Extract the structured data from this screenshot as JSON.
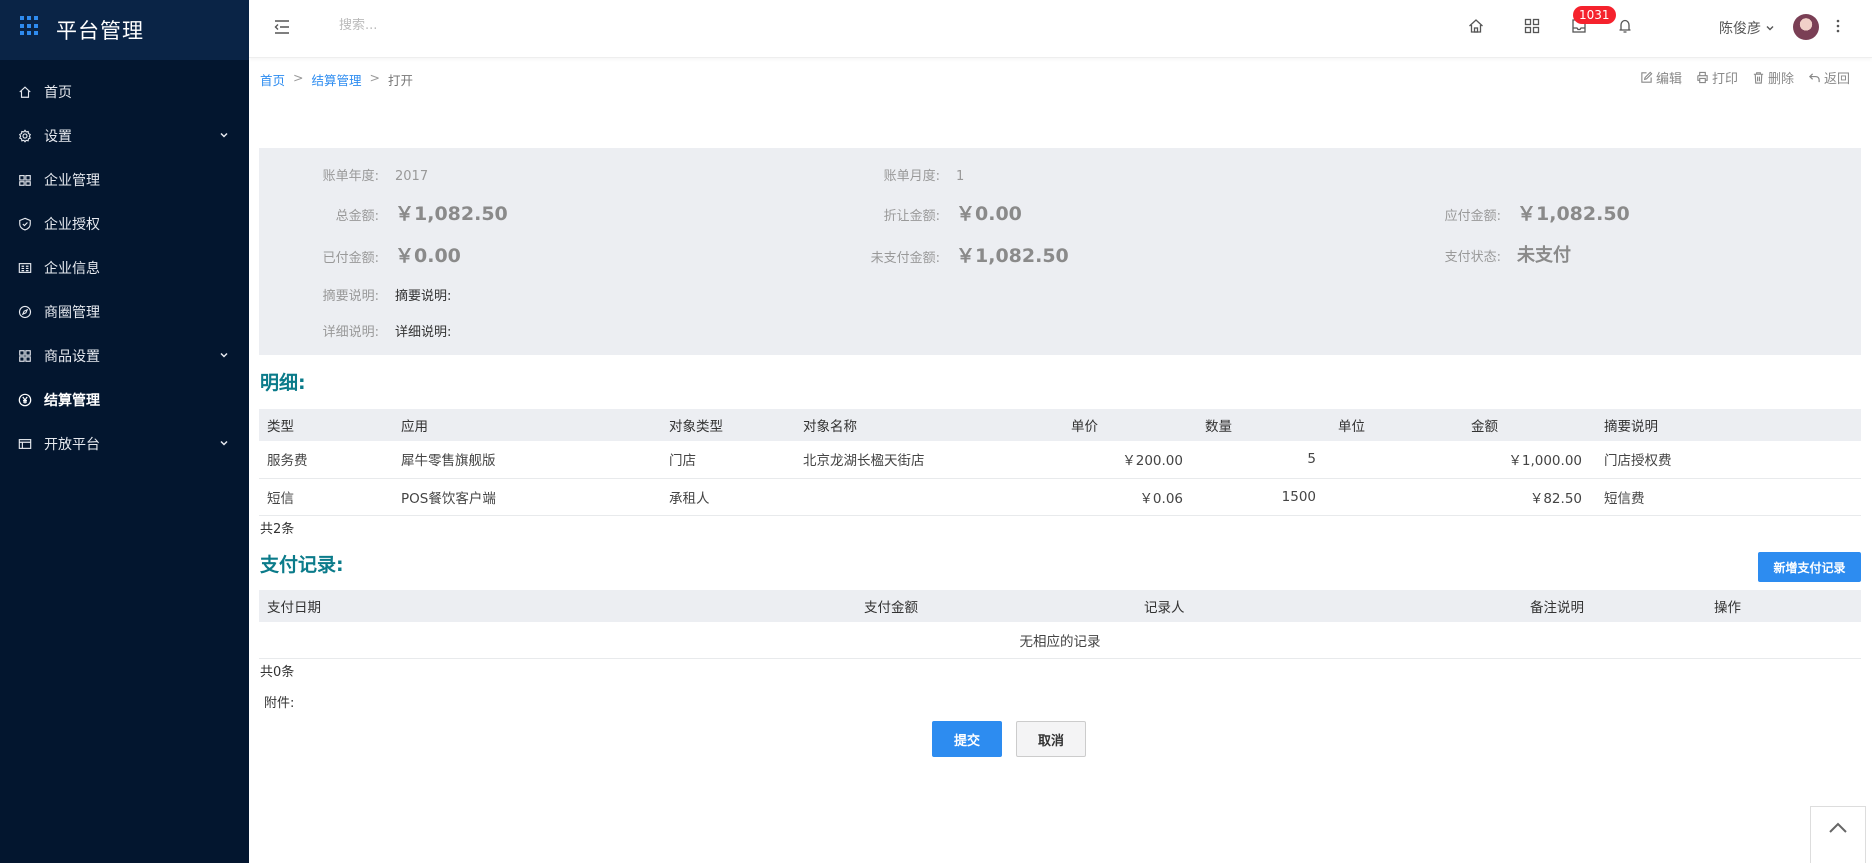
{
  "brand": {
    "title": "平台管理"
  },
  "sidebar": {
    "items": [
      {
        "label": "首页",
        "icon": "home-icon"
      },
      {
        "label": "设置",
        "icon": "gear-icon",
        "expandable": true
      },
      {
        "label": "企业管理",
        "icon": "building-icon"
      },
      {
        "label": "企业授权",
        "icon": "shield-icon"
      },
      {
        "label": "企业信息",
        "icon": "id-card-icon"
      },
      {
        "label": "商圈管理",
        "icon": "compass-icon"
      },
      {
        "label": "商品设置",
        "icon": "grid-icon",
        "expandable": true
      },
      {
        "label": "结算管理",
        "icon": "yen-icon",
        "active": true
      },
      {
        "label": "开放平台",
        "icon": "panel-icon",
        "expandable": true
      }
    ]
  },
  "topbar": {
    "search_placeholder": "搜索...",
    "badge_count": "1031",
    "user_name": "陈俊彦"
  },
  "breadcrumb": {
    "home": "首页",
    "section": "结算管理",
    "current": "打开",
    "sep": ">"
  },
  "actions": {
    "edit": "编辑",
    "print": "打印",
    "delete": "删除",
    "back": "返回"
  },
  "summary": {
    "year_label": "账单年度:",
    "year_value": "2017",
    "month_label": "账单月度:",
    "month_value": "1",
    "total_label": "总金额:",
    "total_value": "￥1,082.50",
    "discount_label": "折让金额:",
    "discount_value": "￥0.00",
    "payable_label": "应付金额:",
    "payable_value": "￥1,082.50",
    "paid_label": "已付金额:",
    "paid_value": "￥0.00",
    "unpaid_label": "未支付金额:",
    "unpaid_value": "￥1,082.50",
    "status_label": "支付状态:",
    "status_value": "未支付",
    "abstract_label": "摘要说明:",
    "abstract_value": "摘要说明:",
    "detail_label": "详细说明:",
    "detail_value": "详细说明:"
  },
  "details": {
    "title": "明细:",
    "headers": [
      "类型",
      "应用",
      "对象类型",
      "对象名称",
      "单价",
      "数量",
      "单位",
      "金额",
      "摘要说明"
    ],
    "rows": [
      [
        "服务费",
        "犀牛零售旗舰版",
        "门店",
        "北京龙湖长楹天街店",
        "￥200.00",
        "5",
        "",
        "￥1,000.00",
        "门店授权费"
      ],
      [
        "短信",
        "POS餐饮客户端",
        "承租人",
        "",
        "￥0.06",
        "1500",
        "",
        "￥82.50",
        "短信费"
      ]
    ],
    "count": "共2条"
  },
  "payments": {
    "title": "支付记录:",
    "add_button": "新增支付记录",
    "headers": [
      "支付日期",
      "支付金额",
      "记录人",
      "备注说明",
      "操作"
    ],
    "empty": "无相应的记录",
    "count": "共0条"
  },
  "attachments": {
    "label": "附件:"
  },
  "form": {
    "submit": "提交",
    "cancel": "取消"
  },
  "colors": {
    "sidebar_bg": "#03162f",
    "accent": "#2d8cf0",
    "section_title": "#0b7b8a",
    "badge": "#f5222d"
  }
}
